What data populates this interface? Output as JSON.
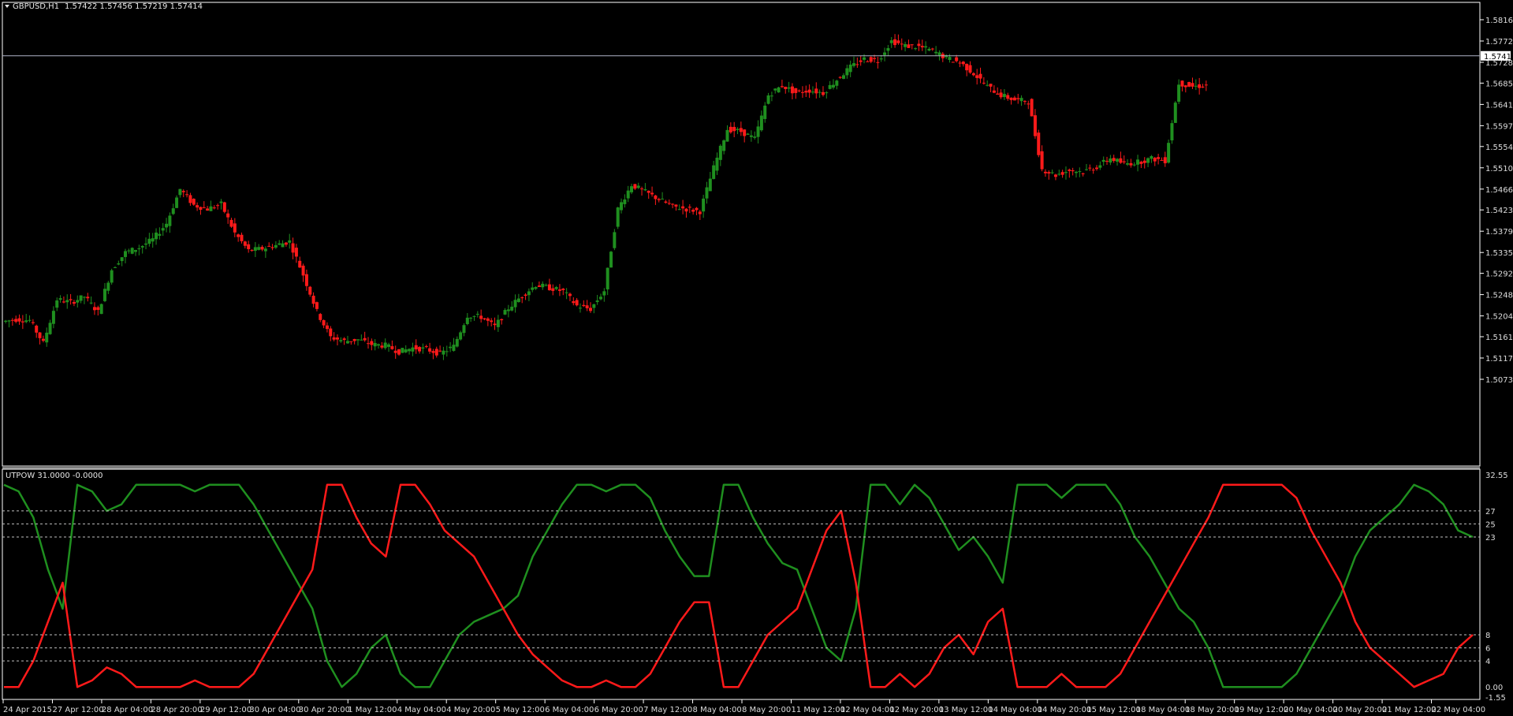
{
  "header": {
    "symbol": "GBPUSD,H1",
    "ohlc": "1.57422 1.57456 1.57219 1.57414"
  },
  "indicator": {
    "label": "UTPOW 31.0000 -0.0000"
  },
  "colors": {
    "background": "#000000",
    "bull": "#1f8f1f",
    "bear": "#ff1a1a",
    "axis": "#ffffff",
    "grid_dash": "#bfbfbf",
    "price_line": "#b0b4c8"
  },
  "chart_data": [
    {
      "type": "candlestick",
      "title": "GBPUSD,H1",
      "current_price": "1.57414",
      "y_ticks": [
        "1.58160",
        "1.57720",
        "1.57280",
        "1.56850",
        "1.56410",
        "1.55970",
        "1.55540",
        "1.55100",
        "1.54660",
        "1.54230",
        "1.53790",
        "1.53350",
        "1.52920",
        "1.52480",
        "1.52040",
        "1.51610",
        "1.51170",
        "1.50730"
      ],
      "ylim": [
        1.5073,
        1.5816
      ],
      "x_ticks": [
        "24 Apr 2015",
        "27 Apr 12:00",
        "28 Apr 04:00",
        "28 Apr 20:00",
        "29 Apr 12:00",
        "30 Apr 04:00",
        "30 Apr 20:00",
        "1 May 12:00",
        "4 May 04:00",
        "4 May 20:00",
        "5 May 12:00",
        "6 May 04:00",
        "6 May 20:00",
        "7 May 12:00",
        "8 May 04:00",
        "8 May 20:00",
        "11 May 12:00",
        "12 May 04:00",
        "12 May 20:00",
        "13 May 12:00",
        "14 May 04:00",
        "14 May 20:00",
        "15 May 12:00",
        "18 May 04:00",
        "18 May 20:00",
        "19 May 12:00",
        "20 May 04:00",
        "20 May 20:00",
        "21 May 12:00",
        "22 May 04:00"
      ],
      "series": [
        {
          "name": "close",
          "values": [
            1.5197,
            1.5195,
            1.5148,
            1.5238,
            1.5232,
            1.5244,
            1.5212,
            1.53,
            1.5335,
            1.5345,
            1.5362,
            1.5395,
            1.5466,
            1.5433,
            1.5425,
            1.5435,
            1.5375,
            1.5339,
            1.5343,
            1.535,
            1.5358,
            1.5289,
            1.5213,
            1.516,
            1.5152,
            1.5155,
            1.5145,
            1.5143,
            1.513,
            1.5138,
            1.5135,
            1.5126,
            1.5141,
            1.5205,
            1.5202,
            1.5182,
            1.522,
            1.5246,
            1.5268,
            1.5262,
            1.5255,
            1.5225,
            1.5218,
            1.5256,
            1.5425,
            1.5475,
            1.546,
            1.5445,
            1.543,
            1.5425,
            1.542,
            1.551,
            1.559,
            1.5585,
            1.557,
            1.566,
            1.568,
            1.5665,
            1.567,
            1.5665,
            1.5692,
            1.5718,
            1.5735,
            1.5732,
            1.5772,
            1.5762,
            1.576,
            1.5752,
            1.5737,
            1.5728,
            1.5705,
            1.5678,
            1.566,
            1.565,
            1.5648,
            1.5507,
            1.5495,
            1.5505,
            1.5502,
            1.5512,
            1.553,
            1.5518,
            1.5522,
            1.5529,
            1.5525,
            1.5685,
            1.5678,
            1.568
          ]
        }
      ]
    },
    {
      "type": "line",
      "title": "UTPOW 31.0000 -0.0000",
      "ylim": [
        -1.55,
        32.55
      ],
      "y_ticks": [
        "32.55",
        "27",
        "25",
        "23",
        "8",
        "6",
        "4",
        "0.00",
        "-1.55"
      ],
      "levels": [
        27,
        25,
        23,
        8,
        6,
        4
      ],
      "series": [
        {
          "name": "",
          "color": "#1f8f1f",
          "values": [
            31,
            30,
            26,
            18,
            12,
            31,
            30,
            27,
            28,
            31,
            31,
            31,
            31,
            30,
            31,
            31,
            31,
            28,
            24,
            20,
            16,
            12,
            4,
            0,
            2,
            6,
            8,
            2,
            0,
            0,
            4,
            8,
            10,
            11,
            12,
            14,
            20,
            24,
            28,
            31,
            31,
            30,
            31,
            31,
            29,
            24,
            20,
            17,
            17,
            31,
            31,
            26,
            22,
            19,
            18,
            12,
            6,
            4,
            12,
            31,
            31,
            28,
            31,
            29,
            25,
            21,
            23,
            20,
            16,
            31,
            31,
            31,
            29,
            31,
            31,
            31,
            28,
            23,
            20,
            16,
            12,
            10,
            6,
            0,
            0,
            0,
            0,
            0,
            2,
            6,
            10,
            14,
            20,
            24,
            26,
            28,
            31,
            30,
            28,
            24,
            23
          ]
        },
        {
          "name": "",
          "color": "#ff1a1a",
          "values": [
            0,
            0,
            4,
            10,
            16,
            0,
            1,
            3,
            2,
            0,
            0,
            0,
            0,
            1,
            0,
            0,
            0,
            2,
            6,
            10,
            14,
            18,
            31,
            31,
            26,
            22,
            20,
            31,
            31,
            28,
            24,
            22,
            20,
            16,
            12,
            8,
            5,
            3,
            1,
            0,
            0,
            1,
            0,
            0,
            2,
            6,
            10,
            13,
            13,
            0,
            0,
            4,
            8,
            10,
            12,
            18,
            24,
            27,
            16,
            0,
            0,
            2,
            0,
            2,
            6,
            8,
            5,
            10,
            12,
            0,
            0,
            0,
            2,
            0,
            0,
            0,
            2,
            6,
            10,
            14,
            18,
            22,
            26,
            31,
            31,
            31,
            31,
            31,
            29,
            24,
            20,
            16,
            10,
            6,
            4,
            2,
            0,
            1,
            2,
            6,
            8
          ]
        }
      ]
    }
  ]
}
